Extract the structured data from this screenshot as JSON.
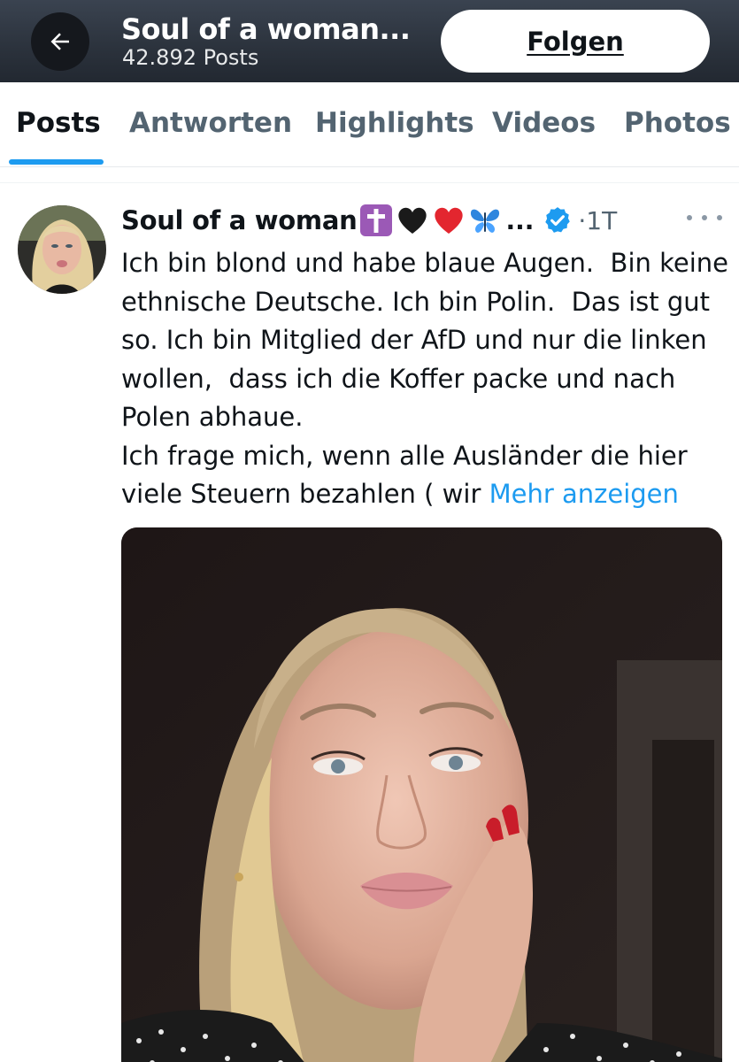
{
  "header": {
    "title": "Soul of a woman...",
    "post_count": "42.892 Posts",
    "follow_label": "Folgen"
  },
  "tabs": [
    {
      "label": "Posts",
      "active": true
    },
    {
      "label": "Antworten",
      "active": false
    },
    {
      "label": "Highlights",
      "active": false
    },
    {
      "label": "Videos",
      "active": false
    },
    {
      "label": "Photos",
      "active": false
    }
  ],
  "post": {
    "author": "Soul of a woman",
    "name_emojis": [
      "latin-cross-icon",
      "black-heart-icon",
      "red-heart-icon",
      "butterfly-icon"
    ],
    "name_ellipsis": "...",
    "verified": true,
    "time": "1T",
    "text": "Ich bin blond und habe blaue Augen.  Bin keine ethnische Deutsche. Ich bin Polin.  Das ist gut so. Ich bin Mitglied der AfD und nur die linken wollen,  dass ich die Koffer packe und nach Polen abhaue.\nIch frage mich, wenn alle Ausländer die hier viele Steuern bezahlen ( wir ",
    "show_more": "Mehr anzeigen"
  },
  "colors": {
    "accent": "#1d9bf0",
    "text_primary": "#0f1419",
    "text_secondary": "#536471",
    "header_bg": "#2b323c"
  }
}
